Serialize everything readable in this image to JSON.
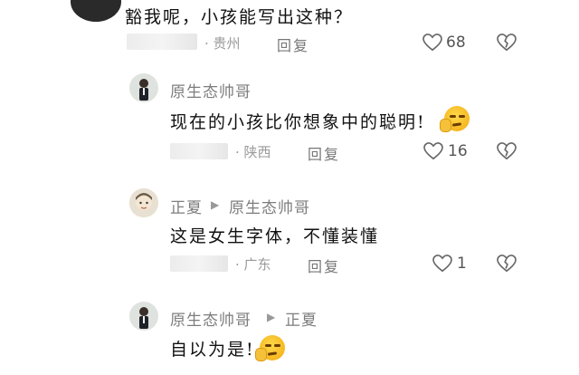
{
  "comments": [
    {
      "id": "top",
      "text": "豁我呢，小孩能写出这种？",
      "location": "· 贵州",
      "reply": "回复",
      "likes": "68"
    },
    {
      "id": "r1",
      "author": "原生态帅哥",
      "text": "现在的小孩比你想象中的聪明!",
      "location": "· 陕西",
      "reply": "回复",
      "likes": "16"
    },
    {
      "id": "r2",
      "author": "正夏",
      "reply_to": "原生态帅哥",
      "text": "这是女生字体，不懂装懂",
      "location": "· 广东",
      "reply": "回复",
      "likes": "1"
    },
    {
      "id": "r3",
      "author": "原生态帅哥",
      "reply_to": "正夏",
      "text": "自以为是!",
      "location": "",
      "reply": "",
      "likes": ""
    }
  ],
  "icons": {
    "like": "heart-outline-icon",
    "dislike": "broken-heart-icon",
    "reply_arrow": "play-triangle-icon",
    "emoji": "thinking-face-emoji"
  }
}
